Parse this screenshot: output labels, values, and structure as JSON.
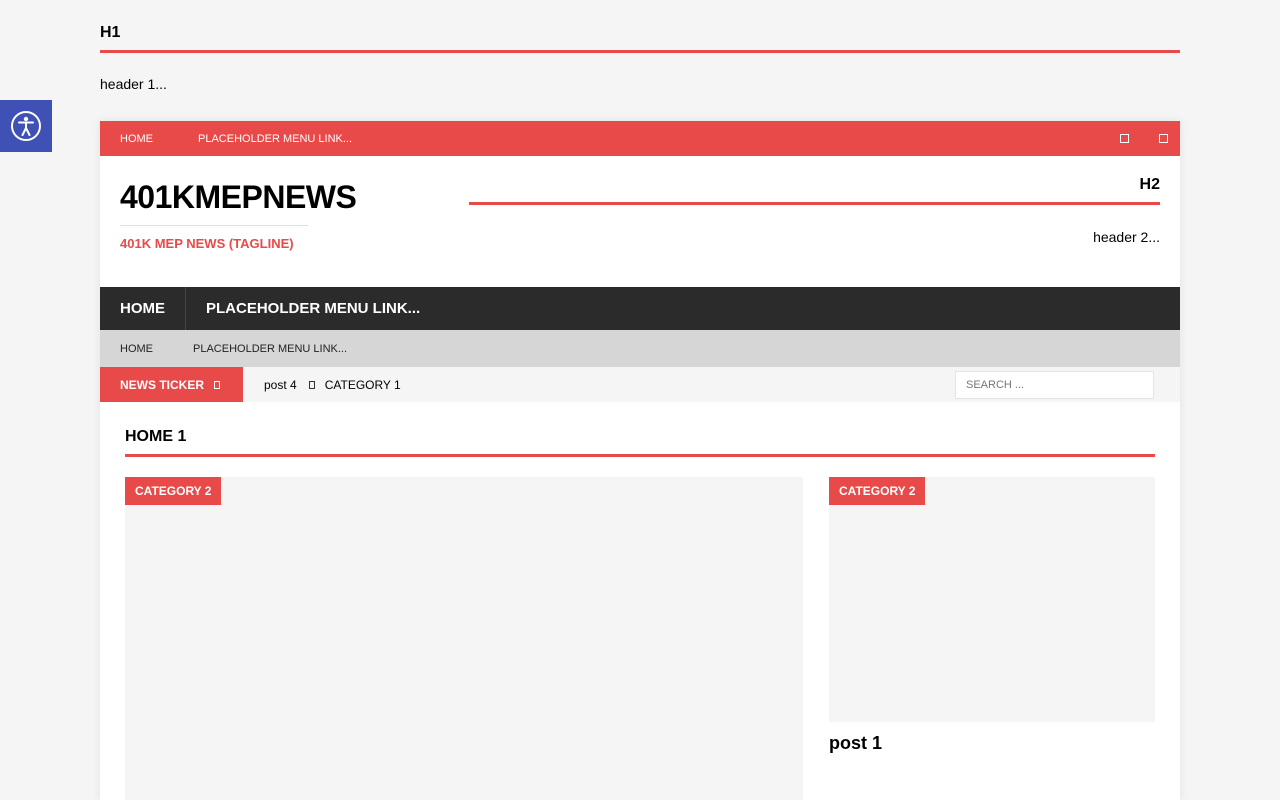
{
  "top_widget": {
    "title": "H1",
    "text": "header 1..."
  },
  "accessibility": {
    "icon": "accessibility-icon",
    "color": "#3f51b5"
  },
  "top_bar": {
    "links": [
      "HOME",
      "PLACEHOLDER MENU LINK..."
    ],
    "icons": [
      "square-icon",
      "square-icon"
    ]
  },
  "header": {
    "site_name": "401KMEPNEWS",
    "tagline": "401K MEP NEWS (TAGLINE)",
    "widget_title": "H2",
    "widget_text": "header 2..."
  },
  "main_nav": {
    "items": [
      "HOME",
      "PLACEHOLDER MENU LINK..."
    ]
  },
  "sub_nav": {
    "items": [
      "HOME",
      "PLACEHOLDER MENU LINK..."
    ]
  },
  "ticker": {
    "label": "NEWS TICKER",
    "post": "post 4",
    "category": "CATEGORY 1"
  },
  "search": {
    "placeholder": "SEARCH ..."
  },
  "main": {
    "section_title": "HOME 1",
    "featured": {
      "main_category": "CATEGORY 2",
      "side_category": "CATEGORY 2",
      "side_title": "post 1"
    }
  },
  "colors": {
    "accent": "#e84a4a",
    "dark_nav": "#2b2b2b",
    "sub_nav": "#d6d6d6"
  }
}
